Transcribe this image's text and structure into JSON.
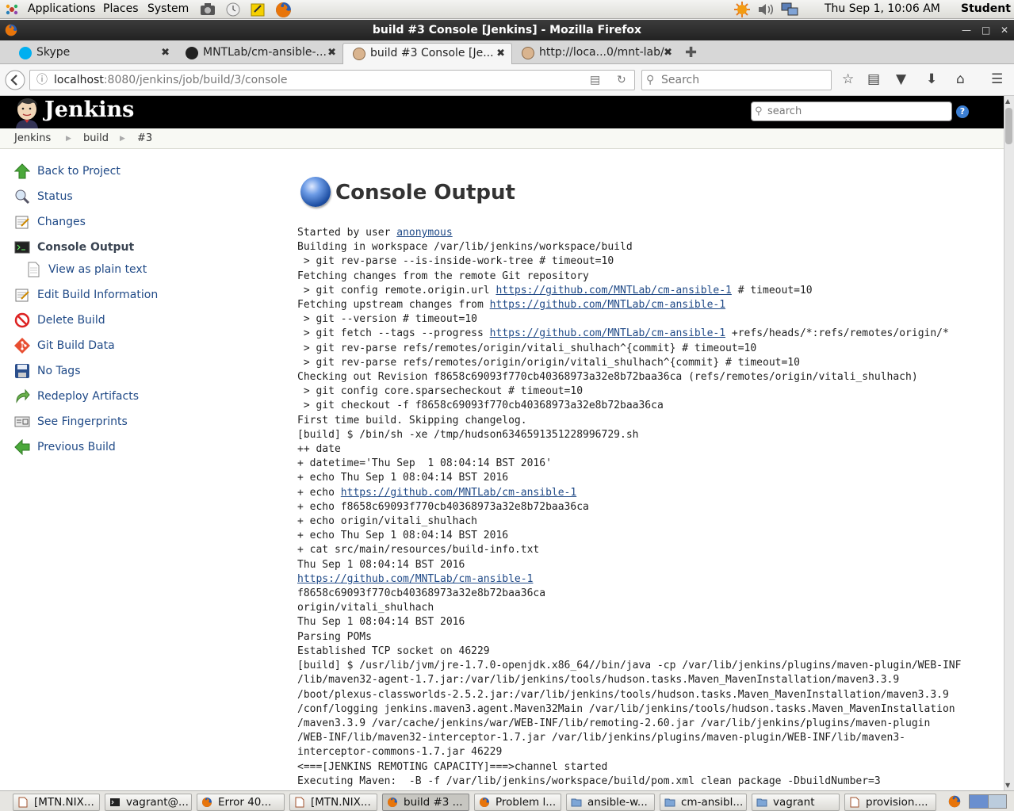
{
  "top_panel": {
    "menus": [
      "Applications",
      "Places",
      "System"
    ],
    "clock": "Thu Sep  1, 10:06 AM",
    "user": "Student"
  },
  "window": {
    "title": "build #3 Console [Jenkins] - Mozilla Firefox"
  },
  "tabs": [
    {
      "label": "Skype",
      "icon": "skype-icon"
    },
    {
      "label": "MNTLab/cm-ansible-...",
      "icon": "github-icon"
    },
    {
      "label": "build #3 Console [Je...",
      "icon": "jenkins-icon",
      "active": true
    },
    {
      "label": "http://loca...0/mnt-lab/",
      "icon": "jenkins-icon"
    }
  ],
  "navbar": {
    "url_host": "localhost",
    "url_path": ":8080/jenkins/job/build/3/console",
    "search_placeholder": "Search"
  },
  "jenkins": {
    "brand": "Jenkins",
    "search_placeholder": "search",
    "help": "?"
  },
  "breadcrumb": [
    "Jenkins",
    "build",
    "#3"
  ],
  "side_panel": [
    {
      "label": "Back to Project",
      "icon": "arrow-up-icon"
    },
    {
      "label": "Status",
      "icon": "magnifier-icon"
    },
    {
      "label": "Changes",
      "icon": "notepad-icon"
    },
    {
      "label": "Console Output",
      "icon": "terminal-icon",
      "current": true
    },
    {
      "label": "View as plain text",
      "icon": "document-icon",
      "sub": true
    },
    {
      "label": "Edit Build Information",
      "icon": "notepad-icon"
    },
    {
      "label": "Delete Build",
      "icon": "no-entry-icon"
    },
    {
      "label": "Git Build Data",
      "icon": "git-icon"
    },
    {
      "label": "No Tags",
      "icon": "floppy-icon"
    },
    {
      "label": "Redeploy Artifacts",
      "icon": "redeploy-icon"
    },
    {
      "label": "See Fingerprints",
      "icon": "fingerprint-icon"
    },
    {
      "label": "Previous Build",
      "icon": "arrow-left-icon"
    }
  ],
  "main": {
    "heading": "Console Output",
    "console_lines": [
      "Started by user <a>anonymous</a>",
      "Building in workspace /var/lib/jenkins/workspace/build",
      " > git rev-parse --is-inside-work-tree # timeout=10",
      "Fetching changes from the remote Git repository",
      " > git config remote.origin.url <a>https://github.com/MNTLab/cm-ansible-1</a> # timeout=10",
      "Fetching upstream changes from <a>https://github.com/MNTLab/cm-ansible-1</a>",
      " > git --version # timeout=10",
      " > git fetch --tags --progress <a>https://github.com/MNTLab/cm-ansible-1</a> +refs/heads/*:refs/remotes/origin/*",
      " > git rev-parse refs/remotes/origin/vitali_shulhach^{commit} # timeout=10",
      " > git rev-parse refs/remotes/origin/origin/vitali_shulhach^{commit} # timeout=10",
      "Checking out Revision f8658c69093f770cb40368973a32e8b72baa36ca (refs/remotes/origin/vitali_shulhach)",
      " > git config core.sparsecheckout # timeout=10",
      " > git checkout -f f8658c69093f770cb40368973a32e8b72baa36ca",
      "First time build. Skipping changelog.",
      "[build] $ /bin/sh -xe /tmp/hudson6346591351228996729.sh",
      "++ date",
      "+ datetime='Thu Sep  1 08:04:14 BST 2016'",
      "+ echo Thu Sep 1 08:04:14 BST 2016",
      "+ echo <a>https://github.com/MNTLab/cm-ansible-1</a>",
      "+ echo f8658c69093f770cb40368973a32e8b72baa36ca",
      "+ echo origin/vitali_shulhach",
      "+ echo Thu Sep 1 08:04:14 BST 2016",
      "+ cat src/main/resources/build-info.txt",
      "Thu Sep 1 08:04:14 BST 2016",
      "<a>https://github.com/MNTLab/cm-ansible-1</a>",
      "f8658c69093f770cb40368973a32e8b72baa36ca",
      "origin/vitali_shulhach",
      "Thu Sep 1 08:04:14 BST 2016",
      "Parsing POMs",
      "Established TCP socket on 46229",
      "[build] $ /usr/lib/jvm/jre-1.7.0-openjdk.x86_64//bin/java -cp /var/lib/jenkins/plugins/maven-plugin/WEB-INF",
      "/lib/maven32-agent-1.7.jar:/var/lib/jenkins/tools/hudson.tasks.Maven_MavenInstallation/maven3.3.9",
      "/boot/plexus-classworlds-2.5.2.jar:/var/lib/jenkins/tools/hudson.tasks.Maven_MavenInstallation/maven3.3.9",
      "/conf/logging jenkins.maven3.agent.Maven32Main /var/lib/jenkins/tools/hudson.tasks.Maven_MavenInstallation",
      "/maven3.3.9 /var/cache/jenkins/war/WEB-INF/lib/remoting-2.60.jar /var/lib/jenkins/plugins/maven-plugin",
      "/WEB-INF/lib/maven32-interceptor-1.7.jar /var/lib/jenkins/plugins/maven-plugin/WEB-INF/lib/maven3-",
      "interceptor-commons-1.7.jar 46229",
      "<===[JENKINS REMOTING CAPACITY]===>channel started",
      "Executing Maven:  -B -f /var/lib/jenkins/workspace/build/pom.xml clean package -DbuildNumber=3"
    ]
  },
  "taskbar": [
    {
      "label": "[MTN.NIX...",
      "icon": "document-icon"
    },
    {
      "label": "vagrant@...",
      "icon": "terminal-icon"
    },
    {
      "label": "Error 40...",
      "icon": "firefox-icon"
    },
    {
      "label": "[MTN.NIX...",
      "icon": "document-icon"
    },
    {
      "label": "build #3 ...",
      "icon": "firefox-icon",
      "active": true
    },
    {
      "label": "Problem l...",
      "icon": "firefox-icon"
    },
    {
      "label": "ansible-w...",
      "icon": "folder-icon"
    },
    {
      "label": "cm-ansibl...",
      "icon": "folder-icon"
    },
    {
      "label": "vagrant",
      "icon": "folder-icon"
    },
    {
      "label": "provision....",
      "icon": "document-icon"
    }
  ],
  "colors": {
    "jenkins_header": "#000000",
    "link": "#204a87",
    "breadcrumb_bg": "#f8f9f4"
  }
}
